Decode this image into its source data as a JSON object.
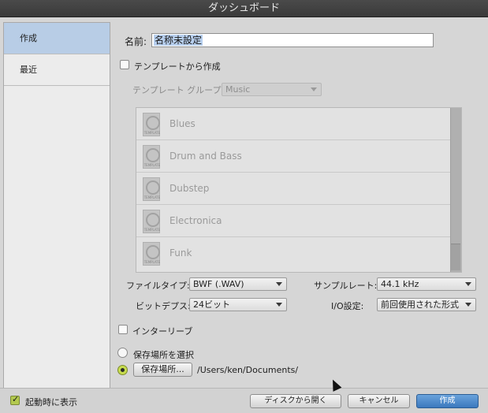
{
  "window": {
    "title": "ダッシュボード"
  },
  "sidebar": {
    "items": [
      {
        "label": "作成",
        "active": true
      },
      {
        "label": "最近",
        "active": false
      }
    ]
  },
  "create": {
    "name_label": "名前:",
    "name_value": "名称未設定",
    "from_template_label": "テンプレートから作成",
    "template_group_label": "テンプレート グループ:",
    "template_group_value": "Music",
    "templates": [
      "Blues",
      "Drum and Bass",
      "Dubstep",
      "Electronica",
      "Funk"
    ],
    "file_type_label": "ファイルタイプ:",
    "file_type_value": "BWF (.WAV)",
    "sample_rate_label": "サンプルレート:",
    "sample_rate_value": "44.1 kHz",
    "bit_depth_label": "ビットデプス:",
    "bit_depth_value": "24ビット",
    "io_label": "I/O設定:",
    "io_value": "前回使用された形式",
    "interleave_label": "インターリーブ",
    "choose_location_label": "保存場所を選択",
    "location_button": "保存場所...",
    "location_path": "/Users/ken/Documents/"
  },
  "footer": {
    "show_on_startup_label": "起動時に表示",
    "open_from_disk": "ディスクから開く",
    "cancel": "キャンセル",
    "create": "作成"
  }
}
